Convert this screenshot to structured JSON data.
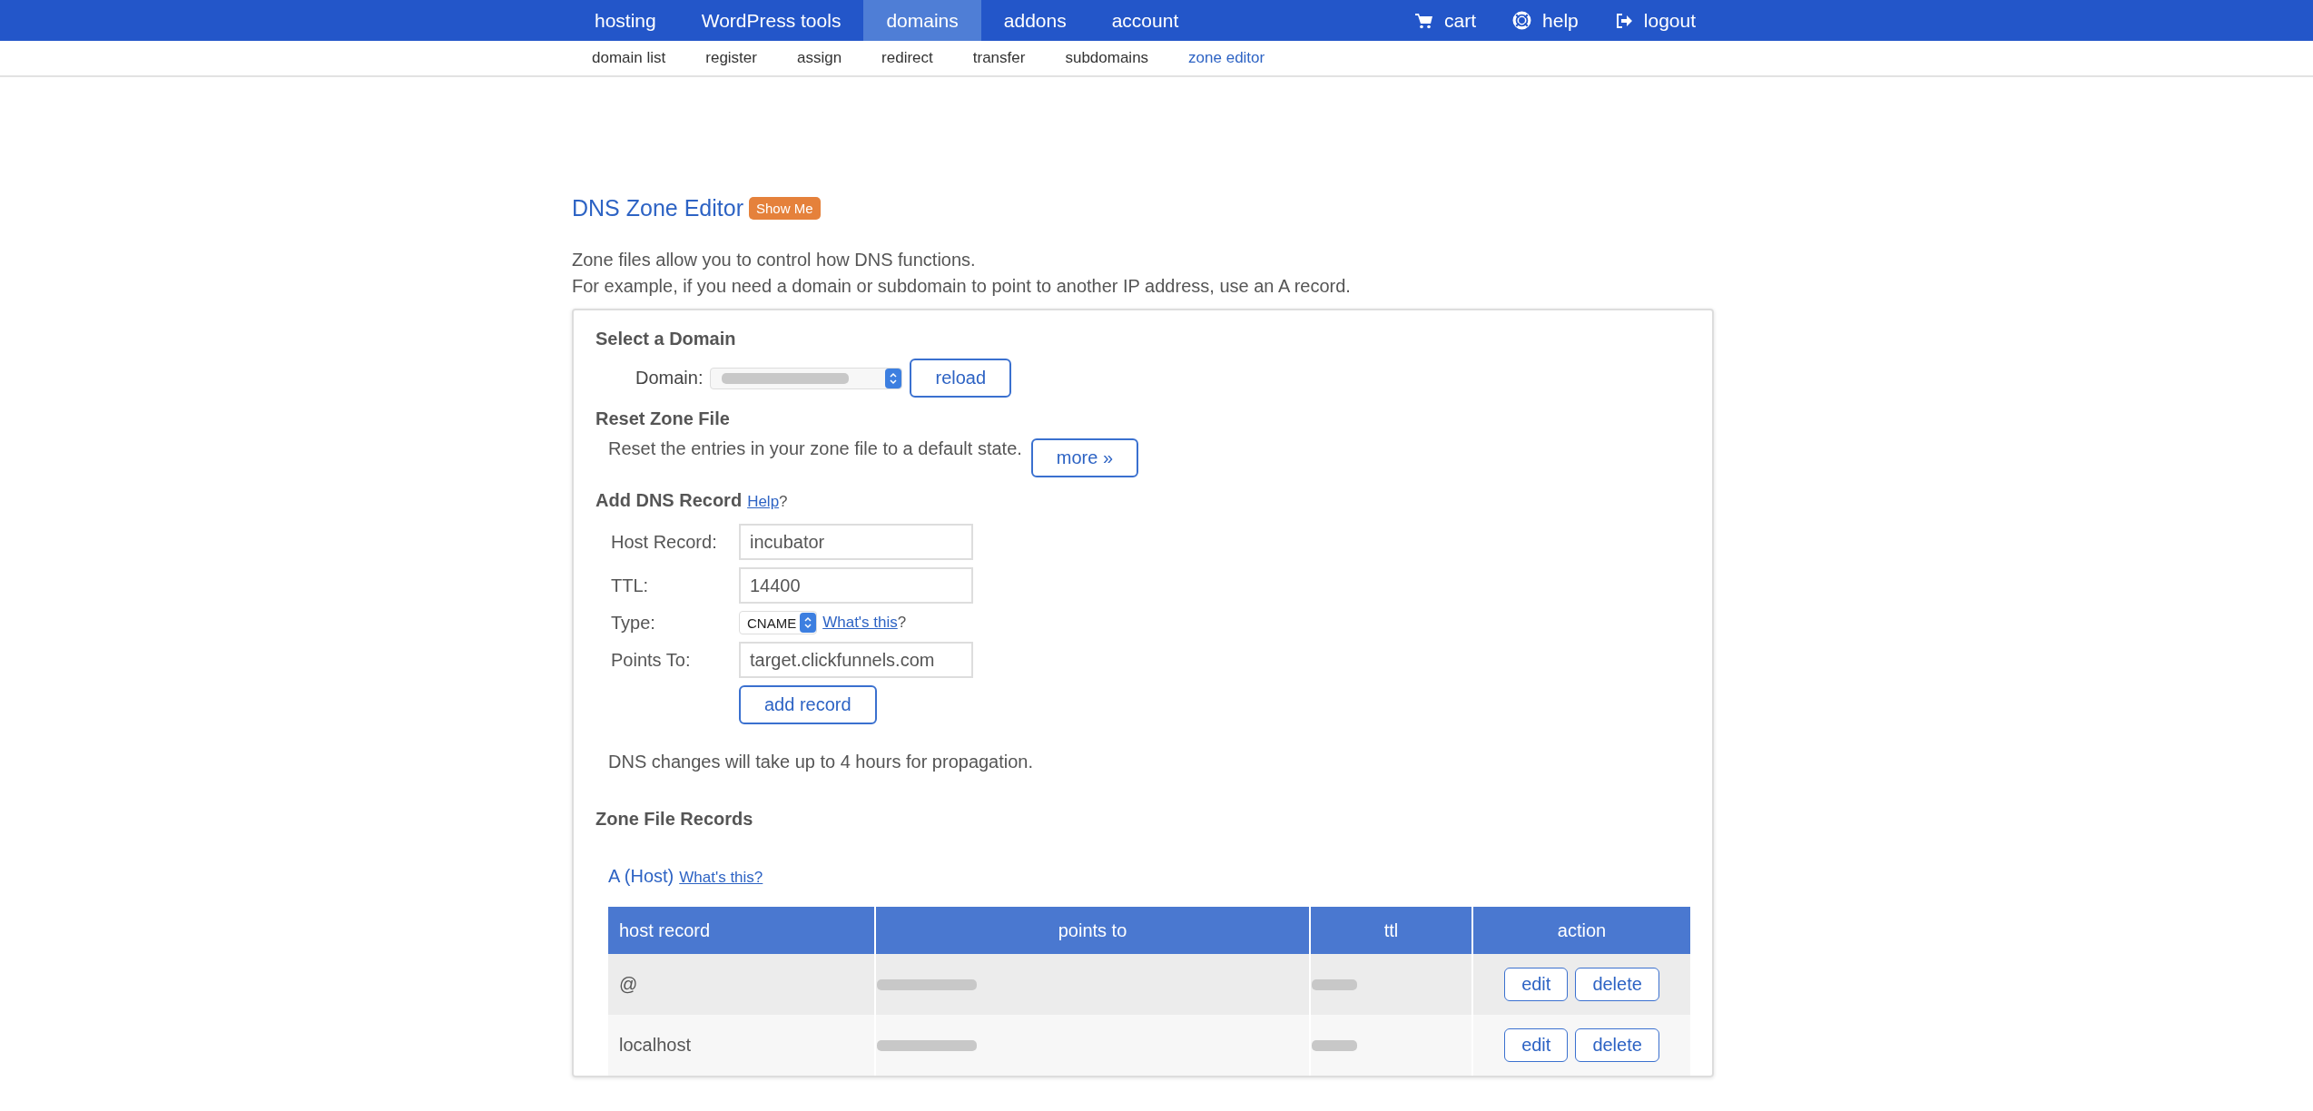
{
  "top_nav": {
    "items": [
      {
        "label": "hosting",
        "selected": false
      },
      {
        "label": "WordPress tools",
        "selected": false
      },
      {
        "label": "domains",
        "selected": true
      },
      {
        "label": "addons",
        "selected": false
      },
      {
        "label": "account",
        "selected": false
      }
    ],
    "right": [
      {
        "label": "cart",
        "kind": "cart"
      },
      {
        "label": "help",
        "kind": "help"
      },
      {
        "label": "logout",
        "kind": "logout"
      }
    ]
  },
  "sub_nav": [
    {
      "label": "domain list",
      "selected": false
    },
    {
      "label": "register",
      "selected": false
    },
    {
      "label": "assign",
      "selected": false
    },
    {
      "label": "redirect",
      "selected": false
    },
    {
      "label": "transfer",
      "selected": false
    },
    {
      "label": "subdomains",
      "selected": false
    },
    {
      "label": "zone editor",
      "selected": true
    }
  ],
  "page": {
    "title": "DNS Zone Editor",
    "badge": "Show Me",
    "intro": [
      "Zone files allow you to control how DNS functions.",
      "For example, if you need a domain or subdomain to point to another IP address, use an A record."
    ]
  },
  "select_domain": {
    "heading": "Select a Domain",
    "label": "Domain:",
    "value_redacted": true,
    "button": "reload"
  },
  "reset_zone": {
    "heading": "Reset Zone File",
    "text": "Reset the entries in your zone file to a default state.",
    "button": "more »"
  },
  "add_record": {
    "heading": "Add DNS Record",
    "help_link": "Help",
    "help_suffix": "?",
    "fields": [
      {
        "kind": "input",
        "label": "Host Record:",
        "value": "incubator"
      },
      {
        "kind": "input",
        "label": "TTL:",
        "value": "14400"
      },
      {
        "kind": "select",
        "label": "Type:",
        "value": "CNAME",
        "link": "What's this",
        "suffix": "?"
      },
      {
        "kind": "input",
        "label": "Points To:",
        "value": "target.clickfunnels.com"
      }
    ],
    "button": "add record",
    "note": "DNS changes will take up to 4 hours for propagation."
  },
  "zone_records": {
    "heading": "Zone File Records",
    "section_title": "A (Host)",
    "section_link": "What's this?",
    "table": {
      "columns": [
        "host record",
        "points to",
        "ttl",
        "action"
      ],
      "rows": [
        {
          "host": "@",
          "points_to_redacted": true,
          "ttl_redacted": true,
          "actions": [
            "edit",
            "delete"
          ]
        },
        {
          "host": "localhost",
          "points_to_redacted": true,
          "ttl_redacted": true,
          "actions": [
            "edit",
            "delete"
          ]
        }
      ]
    }
  }
}
